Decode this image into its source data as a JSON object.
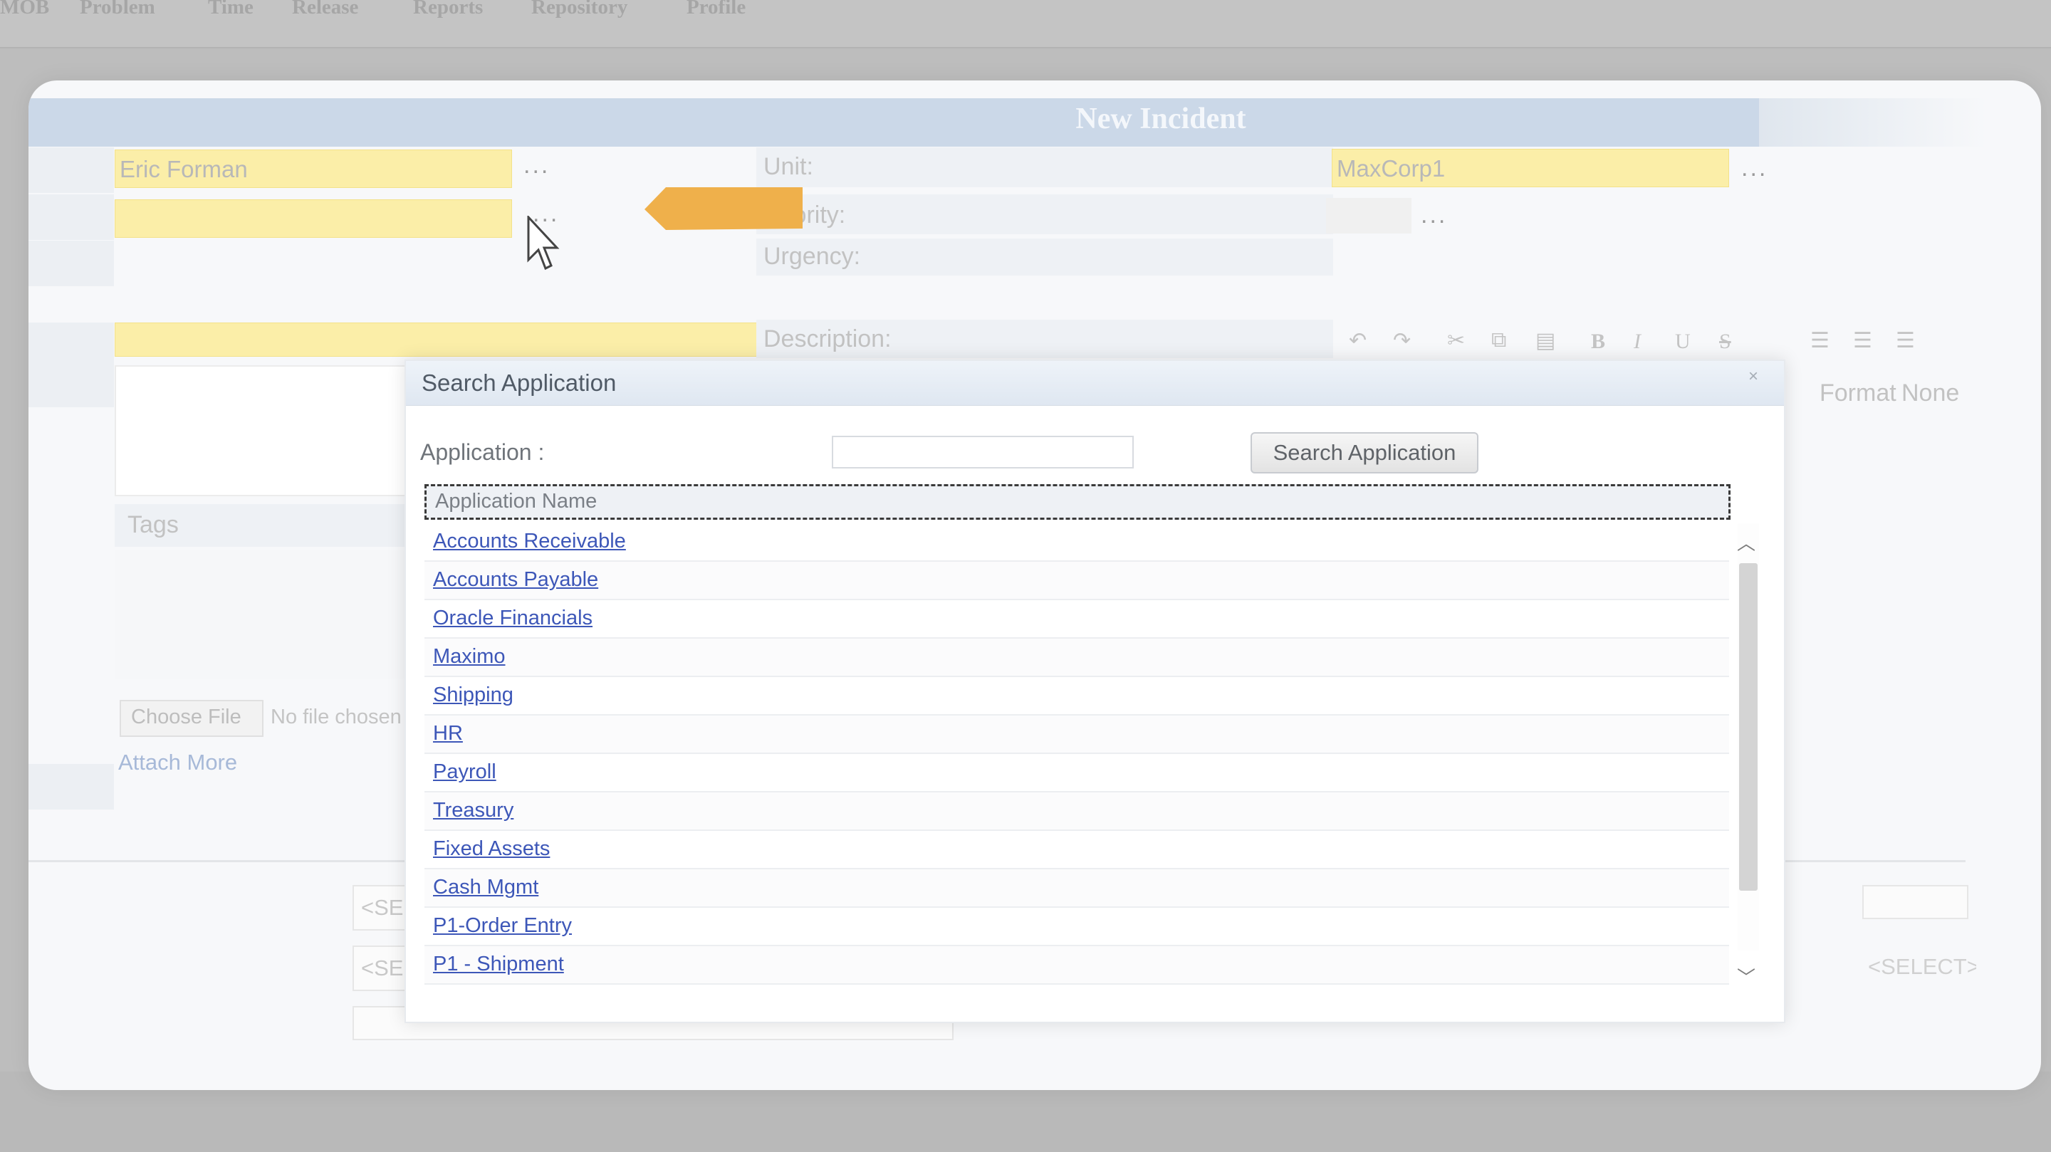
{
  "nav": {
    "items": [
      "MOB",
      "Problem",
      "Time",
      "Release",
      "Reports",
      "Repository",
      "Profile"
    ]
  },
  "form": {
    "title": "New Incident",
    "caller_value": "Eric Forman",
    "unit_label": "Unit:",
    "unit_value": "MaxCorp1",
    "priority_label": "Priority:",
    "urgency_label": "Urgency:",
    "description_label": "Description:",
    "format_label": "Format",
    "format_value": "None",
    "tags_label": "Tags",
    "choose_file_label": "Choose File",
    "no_file_text": "No file chosen",
    "attach_more_label": "Attach More",
    "select_placeholder": "<SELECT>",
    "lookup_dots": "...",
    "rte_bold": "B",
    "rte_italic": "I",
    "rte_underline": "U",
    "rte_strike": "S"
  },
  "modal": {
    "title": "Search Application",
    "close_icon": "×",
    "application_label": "Application :",
    "application_value": "",
    "search_button_label": "Search Application",
    "column_header": "Application Name",
    "rows": [
      "Accounts Receivable",
      "Accounts Payable",
      "Oracle Financials",
      "Maximo",
      "Shipping",
      "HR",
      "Payroll",
      "Treasury",
      "Fixed Assets",
      "Cash Mgmt",
      "P1-Order Entry",
      "P1 - Shipment"
    ]
  },
  "colors": {
    "required_field": "#fbeea8",
    "header_bar": "#cbd8e8",
    "highlight_arrow": "#efb04b",
    "link": "#3d57b8"
  },
  "icons": {
    "cursor": "mouse-pointer-icon",
    "arrow": "highlight-arrow-icon",
    "scroll_up": "chevron-up-icon",
    "scroll_down": "chevron-down-icon"
  }
}
